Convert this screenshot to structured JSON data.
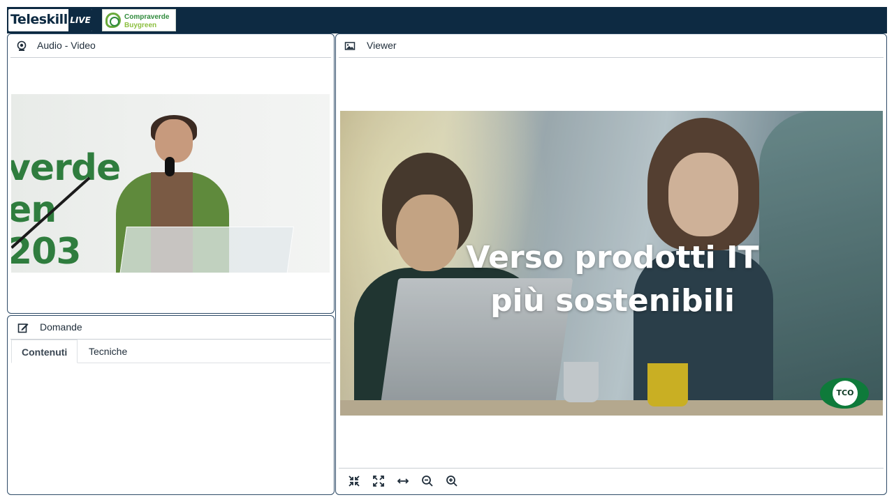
{
  "header": {
    "brand": {
      "name": "Teleskill",
      "badge": "LIVE"
    },
    "partner_logo": {
      "line1": "Compraverde",
      "line2": "Buygreen"
    },
    "colors": {
      "bar": "#0d2a42",
      "partner_green": "#2f8a3c",
      "partner_light": "#8cbf3f"
    }
  },
  "av_panel": {
    "title": "Audio - Video",
    "icon": "webcam-icon",
    "video": {
      "backdrop_text": "verde\nen\n203"
    }
  },
  "questions_panel": {
    "title": "Domande",
    "icon": "edit-icon",
    "tabs": [
      {
        "label": "Contenuti",
        "active": true
      },
      {
        "label": "Tecniche",
        "active": false
      }
    ]
  },
  "viewer_panel": {
    "title": "Viewer",
    "icon": "image-icon",
    "slide": {
      "title_line1": "Verso prodotti IT",
      "title_line2": "più sostenibili",
      "badge": "TCO"
    },
    "toolbar": [
      {
        "name": "compress-icon"
      },
      {
        "name": "expand-icon"
      },
      {
        "name": "fit-width-icon"
      },
      {
        "name": "zoom-out-icon"
      },
      {
        "name": "zoom-in-icon"
      }
    ]
  }
}
